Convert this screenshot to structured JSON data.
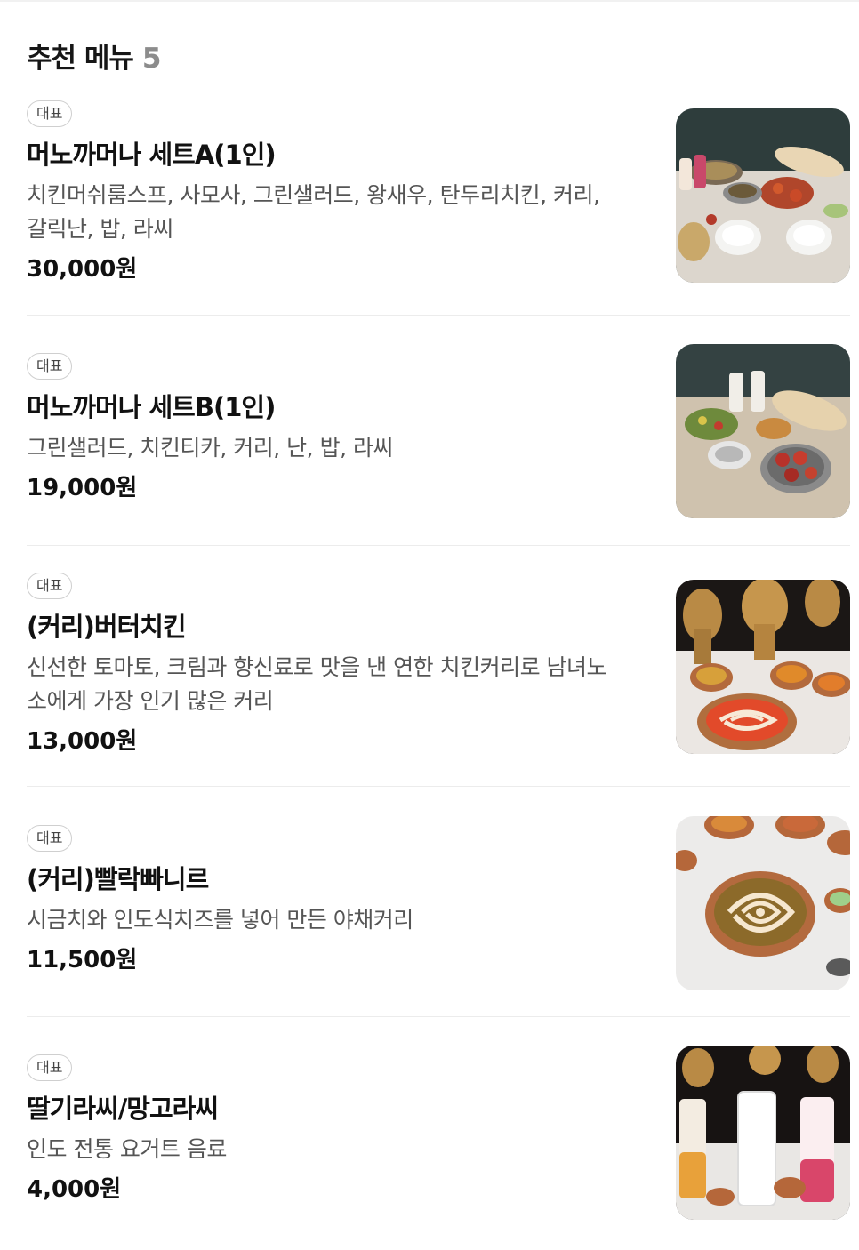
{
  "header": {
    "title": "추천 메뉴",
    "count": "5"
  },
  "items": [
    {
      "badge": "대표",
      "name": "머노까머나 세트A(1인)",
      "desc_lines": [
        "치킨머쉬룸스프, 사모사, 그린샐러드, 왕새우, 탄두리치킨, 커리,",
        "갈릭난, 밥, 라씨"
      ],
      "price": "30,000원"
    },
    {
      "badge": "대표",
      "name": "머노까머나 세트B(1인)",
      "desc_lines": [
        "그린샐러드, 치킨티카, 커리, 난, 밥, 라씨"
      ],
      "price": "19,000원"
    },
    {
      "badge": "대표",
      "name": "(커리)버터치킨",
      "desc_lines": [
        "신선한 토마토, 크림과 향신료로 맛을 낸 연한 치킨커리로 남녀노",
        "소에게 가장 인기 많은 커리"
      ],
      "price": "13,000원"
    },
    {
      "badge": "대표",
      "name": "(커리)빨락빠니르",
      "desc_lines": [
        "시금치와 인도식치즈를 넣어 만든 야채커리"
      ],
      "price": "11,500원"
    },
    {
      "badge": "대표",
      "name": "딸기라씨/망고라씨",
      "desc_lines": [
        "인도 전통 요거트 음료"
      ],
      "price": "4,000원"
    }
  ]
}
